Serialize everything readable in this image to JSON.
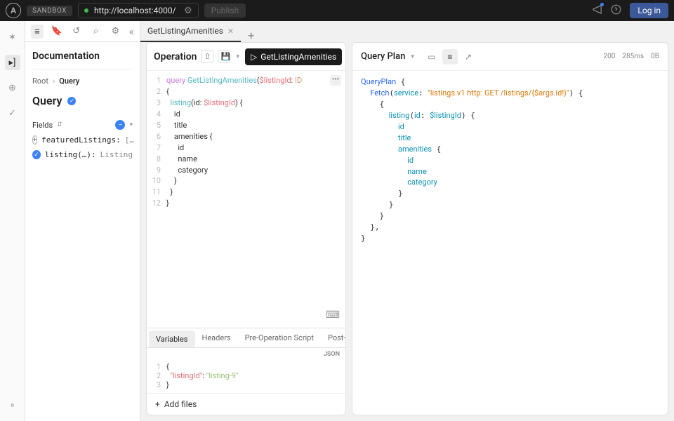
{
  "topbar": {
    "logo_letter": "A",
    "sandbox_label": "SANDBOX",
    "url": "http://localhost:4000/",
    "publish": "Publish",
    "login": "Log in"
  },
  "tabs": {
    "active": "GetListingAmenities"
  },
  "docs": {
    "title": "Documentation",
    "breadcrumb_root": "Root",
    "breadcrumb_current": "Query",
    "type_name": "Query",
    "fields_label": "Fields",
    "field1_name": "featuredListings:",
    "field1_type": "[…",
    "field2_name": "listing(…):",
    "field2_type": "Listing"
  },
  "operation": {
    "header": "Operation",
    "run_label": "GetListingAmenities",
    "lines": [
      "1",
      "2",
      "3",
      "4",
      "5",
      "6",
      "7",
      "8",
      "9",
      "10",
      "11",
      "12"
    ],
    "c1_kw": "query",
    "c1_name": "GetListingAmenities",
    "c1_var": "$listingId",
    "c1_type": "ID",
    "c2_field": "listing",
    "c2_arg": "id",
    "c2_var": "$listingId",
    "c3": "id",
    "c4": "title",
    "c5": "amenities",
    "c6": "id",
    "c7": "name",
    "c8": "category"
  },
  "vars": {
    "tab_variables": "Variables",
    "tab_headers": "Headers",
    "tab_pre": "Pre-Operation Script",
    "tab_post": "Post-Operat",
    "json_label": "JSON",
    "lines": [
      "1",
      "2",
      "3"
    ],
    "key": "\"listingId\"",
    "val": "\"listing-9\"",
    "add_files": "Add files"
  },
  "response": {
    "header": "Query Plan",
    "status": "200",
    "time": "285ms",
    "size": "0B",
    "plan_kw": "QueryPlan",
    "fetch_kw": "Fetch",
    "service_kw": "service",
    "service_val": "\"listings.v1 http: GET /listings/{$args.id!}\"",
    "f_listing": "listing",
    "f_id_arg": "id",
    "f_var": "$listingId",
    "f_id": "id",
    "f_title": "title",
    "f_amenities": "amenities",
    "f_am_id": "id",
    "f_am_name": "name",
    "f_am_cat": "category"
  }
}
